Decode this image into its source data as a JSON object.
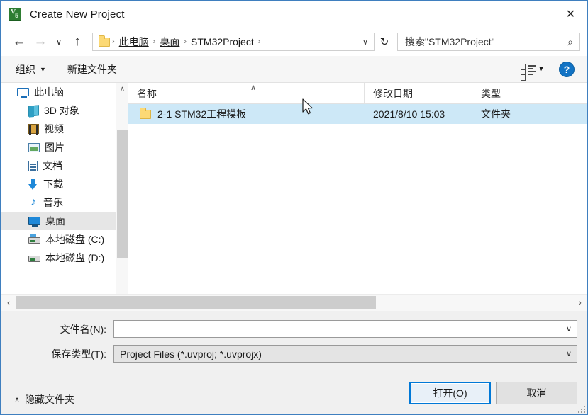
{
  "window": {
    "title": "Create New Project",
    "app_icon": "uvision-v5-icon",
    "icon_v": "V",
    "icon_5": "5",
    "close_label": "✕"
  },
  "nav": {
    "back": "←",
    "forward": "→",
    "recent": "∨",
    "up": "↑",
    "refresh": "↻",
    "address_chevron": "∨",
    "separator": "›",
    "breadcrumbs": [
      {
        "label": "此电脑"
      },
      {
        "label": "桌面"
      },
      {
        "label": "STM32Project"
      }
    ]
  },
  "search": {
    "placeholder": "搜索\"STM32Project\"",
    "icon": "⌕"
  },
  "toolbar": {
    "organize_label": "组织",
    "organize_caret": "▼",
    "new_folder_label": "新建文件夹",
    "view_caret": "▼",
    "help_label": "?"
  },
  "sidebar": {
    "scroll_up": "∧",
    "scroll_down": "∨",
    "items": [
      {
        "label": "此电脑",
        "icon": "computer-icon",
        "level": "root",
        "selected": false
      },
      {
        "label": "3D 对象",
        "icon": "3d-objects-icon",
        "level": "child",
        "selected": false
      },
      {
        "label": "视频",
        "icon": "videos-icon",
        "level": "child",
        "selected": false
      },
      {
        "label": "图片",
        "icon": "pictures-icon",
        "level": "child",
        "selected": false
      },
      {
        "label": "文档",
        "icon": "documents-icon",
        "level": "child",
        "selected": false
      },
      {
        "label": "下载",
        "icon": "downloads-icon",
        "level": "child",
        "selected": false
      },
      {
        "label": "音乐",
        "icon": "music-icon",
        "level": "child",
        "selected": false
      },
      {
        "label": "桌面",
        "icon": "desktop-icon",
        "level": "child",
        "selected": true
      },
      {
        "label": "本地磁盘 (C:)",
        "icon": "system-disk-icon",
        "level": "child",
        "selected": false
      },
      {
        "label": "本地磁盘 (D:)",
        "icon": "disk-icon",
        "level": "child",
        "selected": false
      }
    ]
  },
  "file_list": {
    "columns": [
      {
        "key": "name",
        "label": "名称"
      },
      {
        "key": "date",
        "label": "修改日期"
      },
      {
        "key": "type",
        "label": "类型"
      }
    ],
    "sort_caret": "∧",
    "rows": [
      {
        "name": "2-1 STM32工程模板",
        "date": "2021/8/10 15:03",
        "type": "文件夹",
        "icon": "folder-icon",
        "selected": true
      }
    ]
  },
  "hscroll": {
    "left_arrow": "‹",
    "right_arrow": "›"
  },
  "form": {
    "filename_label": "文件名(N):",
    "filename_value": "",
    "filetype_label": "保存类型(T):",
    "filetype_value": "Project Files (*.uvproj; *.uvprojx)",
    "chevron": "∨"
  },
  "footer": {
    "hide_folders_caret": "∧",
    "hide_folders_label": "隐藏文件夹",
    "open_label": "打开(O)",
    "cancel_label": "取消"
  },
  "colors": {
    "accent": "#0078d7",
    "selection": "#cde8f7",
    "sidebar_selection": "#e6e6e6",
    "folder": "#fcd975",
    "help_blue": "#1273c4",
    "app_green": "#2e7d32"
  }
}
